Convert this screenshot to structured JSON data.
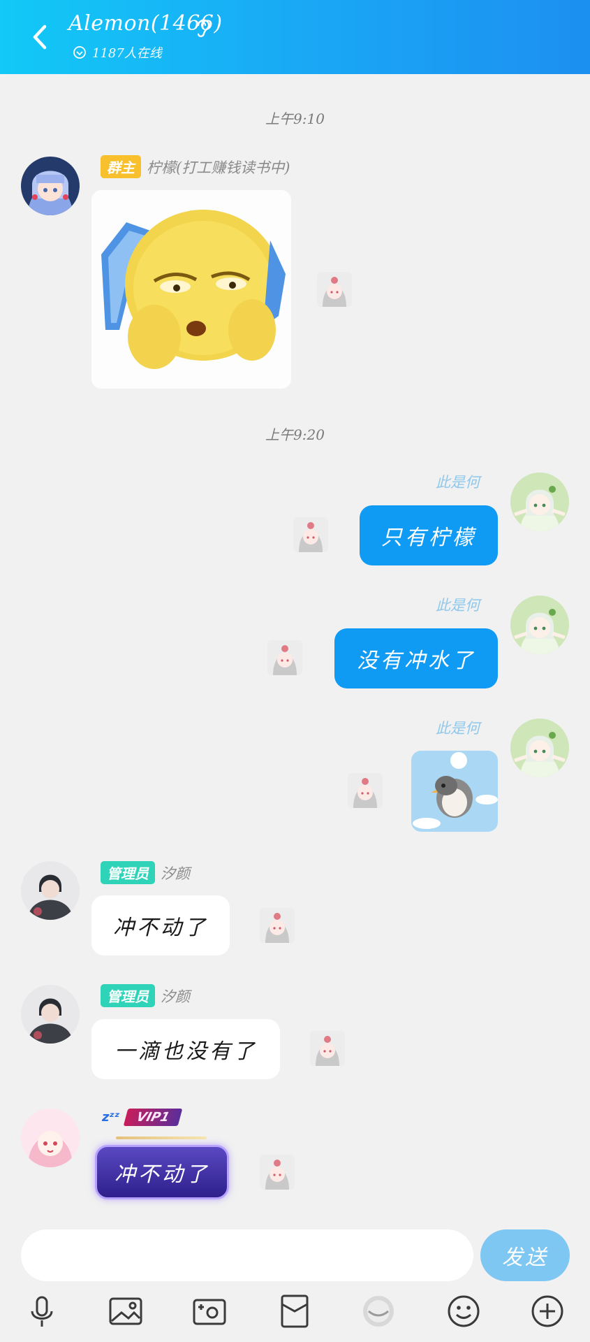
{
  "header": {
    "title": "Alemon(1466)",
    "online_text": "1187人在线"
  },
  "timestamps": [
    "上午9:10",
    "上午9:20"
  ],
  "messages": [
    {
      "sender": "柠檬(打工赚钱读书中)",
      "badge": "群主",
      "type": "sticker",
      "sticker": "yellow-emoji-phone-sticker"
    },
    {
      "sender": "此是何",
      "type": "text",
      "text": "只有柠檬"
    },
    {
      "sender": "此是何",
      "type": "text",
      "text": "没有冲水了"
    },
    {
      "sender": "此是何",
      "type": "sticker",
      "sticker": "penguin-sticker"
    },
    {
      "sender": "汐颜",
      "badge": "管理员",
      "type": "text",
      "text": "冲不动了"
    },
    {
      "sender": "汐颜",
      "badge": "管理员",
      "type": "text",
      "text": "一滴也没有了"
    },
    {
      "sender": "",
      "badge": "VIP1",
      "type": "text",
      "text": "冲不动了"
    }
  ],
  "input": {
    "placeholder": "",
    "send_label": "发送"
  },
  "toolbar": [
    "microphone-icon",
    "image-icon",
    "camera-icon",
    "red-packet-icon",
    "game-icon",
    "emoji-icon",
    "plus-icon"
  ],
  "colors": {
    "header_gradient_start": "#12c9f7",
    "header_gradient_end": "#1c8ff0",
    "bubble_blue": "#0f9af3",
    "send_button": "#7ec7f3",
    "badge_owner": "#f8c02d",
    "badge_admin": "#2fd3b8",
    "background": "#f1f1f1"
  }
}
